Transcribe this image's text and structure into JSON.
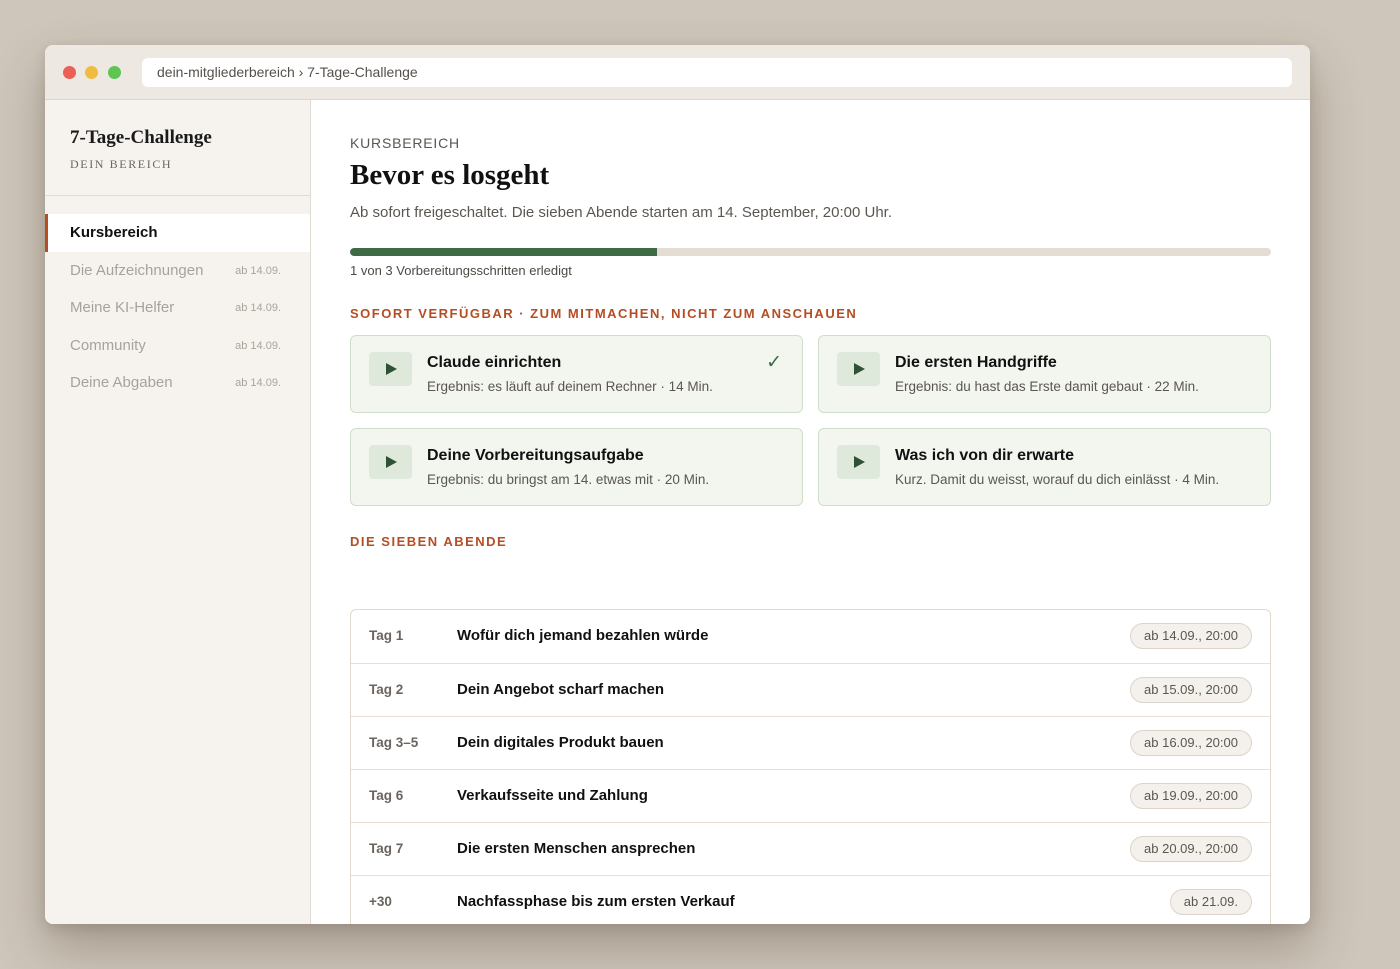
{
  "browser": {
    "url": "dein-mitgliederbereich › 7-Tage-Challenge"
  },
  "sidebar": {
    "title": "7-Tage-Challenge",
    "subtitle": "DEIN BEREICH",
    "items": [
      {
        "label": "Kursbereich",
        "date": "",
        "active": true
      },
      {
        "label": "Die Aufzeichnungen",
        "date": "ab 14.09."
      },
      {
        "label": "Meine KI-Helfer",
        "date": "ab 14.09."
      },
      {
        "label": "Community",
        "date": "ab 14.09."
      },
      {
        "label": "Deine Abgaben",
        "date": "ab 14.09."
      }
    ]
  },
  "main": {
    "eyebrow": "KURSBEREICH",
    "title": "Bevor es losgeht",
    "lead": "Ab sofort freigeschaltet. Die sieben Abende starten am 14. September, 20:00 Uhr.",
    "progress": {
      "completed": 1,
      "total": 3,
      "label": "1 von 3 Vorbereitungsschritten erledigt"
    },
    "section_immediate": "SOFORT VERFÜGBAR · ZUM MITMACHEN, NICHT ZUM ANSCHAUEN",
    "cards": [
      {
        "title": "Claude einrichten",
        "subtitle": "Ergebnis: es läuft auf deinem Rechner · 14 Min.",
        "done": true,
        "check": "✓"
      },
      {
        "title": "Die ersten Handgriffe",
        "subtitle": "Ergebnis: du hast das Erste damit gebaut · 22 Min.",
        "done": false
      },
      {
        "title": "Deine Vorbereitungsaufgabe",
        "subtitle": "Ergebnis: du bringst am 14. etwas mit · 20 Min.",
        "done": false
      },
      {
        "title": "Was ich von dir erwarte",
        "subtitle": "Kurz. Damit du weisst, worauf du dich einlässt · 4 Min.",
        "done": false
      }
    ],
    "section_days": "DIE SIEBEN ABENDE",
    "days": [
      {
        "day": "Tag 1",
        "title": "Wofür dich jemand bezahlen würde",
        "date": "ab 14.09., 20:00"
      },
      {
        "day": "Tag 2",
        "title": "Dein Angebot scharf machen",
        "date": "ab 15.09., 20:00"
      },
      {
        "day": "Tag 3–5",
        "title": "Dein digitales Produkt bauen",
        "date": "ab 16.09., 20:00"
      },
      {
        "day": "Tag 6",
        "title": "Verkaufsseite und Zahlung",
        "date": "ab 19.09., 20:00"
      },
      {
        "day": "Tag 7",
        "title": "Die ersten Menschen ansprechen",
        "date": "ab 20.09., 20:00"
      },
      {
        "day": "+30",
        "title": "Nachfassphase bis zum ersten Verkauf",
        "date": "ab 21.09."
      }
    ]
  },
  "colors": {
    "accent": "#b54d23",
    "progress": "#3e6b45",
    "card_bg": "#f2f6ef",
    "page_bg": "#cfc6bb"
  }
}
